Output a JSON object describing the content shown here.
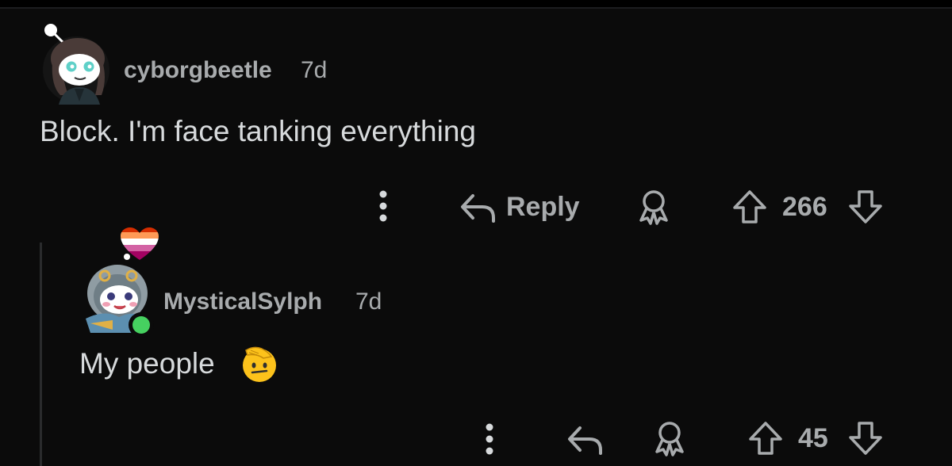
{
  "comments": [
    {
      "username": "cyborgbeetle",
      "age": "7d",
      "body": "Block. I'm face tanking everything",
      "reply_label": "Reply",
      "votes": "266",
      "avatar_icon": "snoo-avatar-icon"
    },
    {
      "username": "MysticalSylph",
      "age": "7d",
      "body": "My people",
      "votes": "45",
      "avatar_icon": "snoo-avatar-icon",
      "flair_icon": "lesbian-pride-heart-icon",
      "online_status": "online",
      "emoji_icon": "saluting-face-emoji-icon"
    }
  ],
  "colors": {
    "background": "#0b0b0b",
    "username": "#a8abad",
    "body_text": "#d7dadc",
    "icon": "#a8abad",
    "online": "#46d160"
  }
}
